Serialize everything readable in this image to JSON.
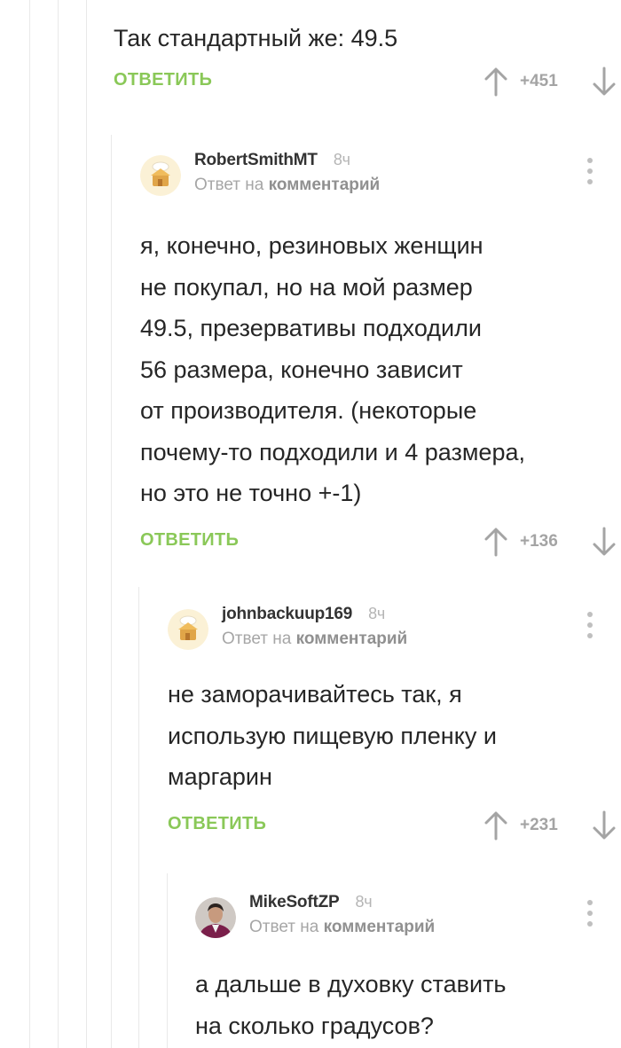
{
  "top_comment": {
    "text": "Так стандартный же: 49.5",
    "reply_label": "ОТВЕТИТЬ",
    "rating": "+451"
  },
  "replies": [
    {
      "author": "RobertSmithMT",
      "time": "8ч",
      "reply_prefix": "Ответ на",
      "reply_target": "комментарий",
      "text": "я, конечно, резиновых женщин\nне покупал, но на мой размер\n49.5, презервативы подходили\n56 размера, конечно зависит\nот производителя. (некоторые\nпочему-то подходили и 4 размера,\nно это не точно +-1)",
      "reply_label": "ОТВЕТИТЬ",
      "rating": "+136",
      "avatar_icon": "pikabu-default-avatar-icon"
    },
    {
      "author": "johnbackuup169",
      "time": "8ч",
      "reply_prefix": "Ответ на",
      "reply_target": "комментарий",
      "text": "не заморачивайтесь так, я\nиспользую пищевую пленку и\nмаргарин",
      "reply_label": "ОТВЕТИТЬ",
      "rating": "+231",
      "avatar_icon": "pikabu-default-avatar-icon"
    },
    {
      "author": "MikeSoftZP",
      "time": "8ч",
      "reply_prefix": "Ответ на",
      "reply_target": "комментарий",
      "text": "а дальше в духовку ставить\nна сколько градусов?",
      "avatar_icon": "user-photo-avatar"
    }
  ],
  "colors": {
    "reply_green": "#8ac858",
    "muted_gray": "#a4a4a4",
    "thread_line": "#e9e9e9"
  }
}
